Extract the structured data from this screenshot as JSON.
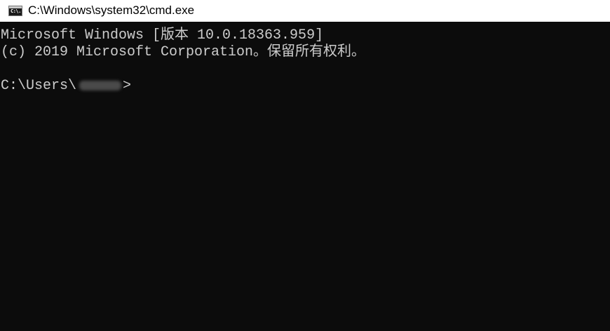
{
  "window": {
    "title": "C:\\Windows\\system32\\cmd.exe",
    "icon": "cmd-console-icon",
    "icon_glyph": "C:\\."
  },
  "console": {
    "lines": [
      "Microsoft Windows [版本 10.0.18363.959]",
      "(c) 2019 Microsoft Corporation。保留所有权利。"
    ],
    "prompt_prefix": "C:\\Users\\",
    "prompt_suffix": ">"
  },
  "colors": {
    "background": "#0c0c0c",
    "foreground": "#cccccc",
    "titlebar": "#ffffff"
  }
}
